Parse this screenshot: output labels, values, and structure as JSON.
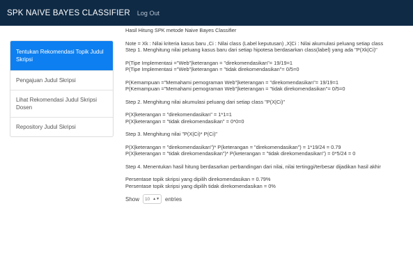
{
  "navbar": {
    "brand": "SPK NAIVE BAYES CLASSIFIER",
    "logout": "Log Out"
  },
  "sidebar": {
    "items": [
      {
        "label": "Tentukan Rekomendasi Topik Judul Skripsi",
        "active": true
      },
      {
        "label": "Pengajuan Judul Skripsi",
        "active": false
      },
      {
        "label": "Lihat Rekomendasi Judul Skripsi Dosen",
        "active": false
      },
      {
        "label": "Repository Judul Skripsi",
        "active": false
      }
    ]
  },
  "content": {
    "heading": "Hasil Hitung SPK metode Naive Bayes Classifier",
    "note": "Note = Xk : Nilai kriteria kasus baru ,Ci : Nilai class (Label keputusan) ,X|Ci : Nilai akumulasi peluang setiap class",
    "step1": "Step 1. Menghitung nilai peluang kasus baru dari setiap hipotesa berdasarkan class(label) yang ada \"P(Xk|Ci)\"",
    "p1": "P(Tipe Implementasi =\"Web\"|keterangan = \"direkomendasikan\"= 19/19=1",
    "p2": "P(Tipe Implementasi =\"Web\"|keterangan = \"tidak direkomendasikan\"= 0/5=0",
    "p3": "P(Kemampuan =\"Memahami pemograman Web\"|keterangan = \"direkomendasikan\"= 19/19=1",
    "p4": "P(Kemampuan =\"Memahami pemograman Web\"|keterangan = \"tidak direkomendasikan\"= 0/5=0",
    "step2": "Step 2. Menghitung nilai akumulasi peluang dari setiap class \"P(X|Ci)\"",
    "x1": "P(X|keterangan = \"direkomendasikan\" = 1*1=1",
    "x2": "P(X|keterangan = \"tidak direkomendasikan\" = 0*0=0",
    "step3": "Step 3. Menghitung nilai \"P(X|Ci)* P(Ci)\"",
    "r1": "P(X|keterangan = \"direkomendasikan\")* P(keterangan = \"direkomendasikan\") = 1*19/24 = 0.79",
    "r2": "P(X|keterangan = \"tidak direkomendasikan\")* P(keterangan = \"tidak direkomendasikan\") = 0*5/24 = 0",
    "step4": "Step 4. Menentukan hasil hitung berdasarkan perbandingan dari nilai, nilai tertinggi/terbesar dijadikan hasil akhir",
    "pct1": "Persentase topik skripsi yang dipilih direkomendasikan = 0.79%",
    "pct2": "Persentase topik skripsi yang dipilih tidak direkomendasikan = 0%"
  },
  "table_controls": {
    "show_label": "Show",
    "entries_value": "10",
    "entries_label": "entries"
  }
}
